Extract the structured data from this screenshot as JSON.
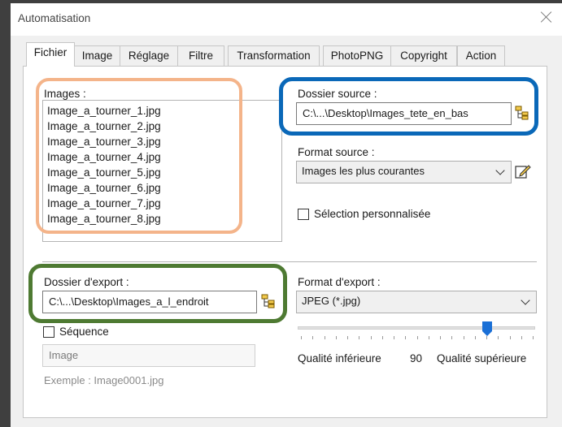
{
  "window": {
    "title": "Automatisation"
  },
  "tabs": [
    "Fichier",
    "Image",
    "Réglage",
    "Filtre",
    "Transformation",
    "PhotoPNG",
    "Copyright",
    "Action"
  ],
  "images": {
    "label": "Images :",
    "items": [
      "Image_a_tourner_1.jpg",
      "Image_a_tourner_2.jpg",
      "Image_a_tourner_3.jpg",
      "Image_a_tourner_4.jpg",
      "Image_a_tourner_5.jpg",
      "Image_a_tourner_6.jpg",
      "Image_a_tourner_7.jpg",
      "Image_a_tourner_8.jpg"
    ]
  },
  "source": {
    "label": "Dossier source :",
    "value": "C:\\...\\Desktop\\Images_tete_en_bas",
    "format_label": "Format source :",
    "format_value": "Images les plus courantes",
    "custom_selection_label": "Sélection personnalisée",
    "custom_selection_checked": false
  },
  "export": {
    "label": "Dossier d'export :",
    "value": "C:\\...\\Desktop\\Images_a_l_endroit",
    "sequence_label": "Séquence",
    "sequence_checked": false,
    "sequence_value": "Image",
    "example": "Exemple : Image0001.jpg",
    "format_label": "Format d'export :",
    "format_value": "JPEG (*.jpg)"
  },
  "quality": {
    "low_label": "Qualité inférieure",
    "value": "90",
    "high_label": "Qualité supérieure",
    "level": 90
  },
  "highlight_colors": {
    "images": "#f4b48a",
    "source": "#0a68b8",
    "export": "#4e7a32"
  },
  "icons": [
    "close-icon",
    "folder-tree-icon",
    "edit-icon",
    "chevron-down-icon",
    "slider-thumb"
  ]
}
